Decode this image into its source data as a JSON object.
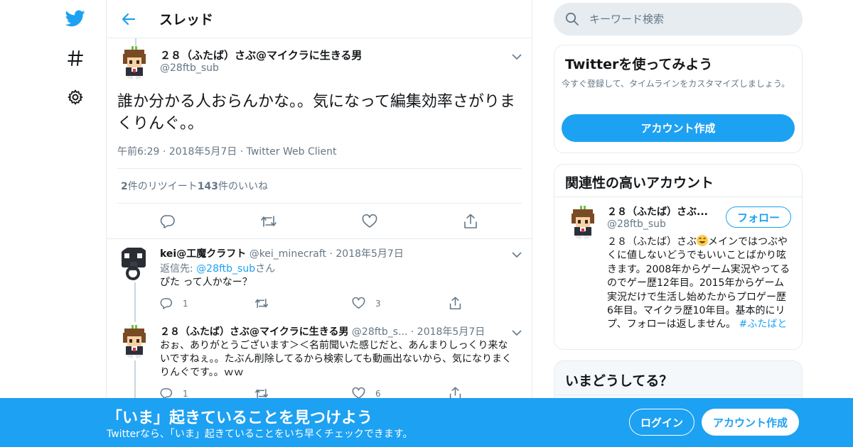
{
  "header": {
    "title": "スレッド"
  },
  "focus_tweet": {
    "name": "２８（ふたば）さぶ@マイクラに生きる男",
    "handle": "@28ftb_sub",
    "text": "誰か分かる人おらんかな。。気になって編集効率さがりまくりんぐ。。",
    "time": "午前6:29",
    "date": "2018年5月7日",
    "client": "Twitter Web Client",
    "retweet_count": "2",
    "retweet_label": "件のリツイート",
    "like_count": "143",
    "like_label": "件のいいね"
  },
  "replies": [
    {
      "name": "kei@工魔クラフト",
      "handle": "@kei_minecraft",
      "date": "2018年5月7日",
      "reply_to_prefix": "返信先: ",
      "reply_to_handle": "@28ftb_sub",
      "reply_to_suffix": "さん",
      "text": "ぴた って人かなー？",
      "reply_count": "1",
      "like_count": "3"
    },
    {
      "name": "２８（ふたば）さぶ@マイクラに生きる男",
      "handle": "@28ftb_s...",
      "date": "2018年5月7日",
      "text": "おぉ、ありがとうございます＞＜名前聞いた感じだと、あんまりしっくり来ないですねぇ。。たぶん削除してるから検索しても動画出ないから、気になりまくりんぐです。。ｗｗ",
      "reply_count": "1",
      "like_count": "6"
    }
  ],
  "sidebar": {
    "search_placeholder": "キーワード検索",
    "signup_card": {
      "title": "Twitterを使ってみよう",
      "text": "今すぐ登録して、タイムラインをカスタマイズしましょう。",
      "button": "アカウント作成"
    },
    "related_card": {
      "title": "関連性の高いアカウント",
      "name": "２８（ふたば）さぶ...",
      "handle": "@28ftb_sub",
      "follow": "フォロー",
      "bio_before": "２８（ふたば）さぶ",
      "bio_after": "メインではつぶやくに値しないどうでもいいことばかり呟きます。2008年からゲーム実況やってるのでゲー歴12年目。2015年からゲーム実況だけで生活し始めたからプロゲー歴6年目。マイクラ歴10年目。基本的にリプ、フォローは返しません。",
      "hashtag": "#ふたばと"
    },
    "trends_card": {
      "title": "いまどうしてる？"
    }
  },
  "banner": {
    "headline": "「いま」起きていることを見つけよう",
    "subtext": "Twitterなら、「いま」起きていることをいち早くチェックできます。",
    "login": "ログイン",
    "signup": "アカウント作成"
  },
  "colors": {
    "accent": "#1da1f2",
    "text": "#14171a",
    "muted": "#657786",
    "border": "#e6ecf0"
  },
  "icons": [
    "twitter-bird-icon",
    "hashtag-icon",
    "gear-icon",
    "back-arrow-icon",
    "chevron-down-icon",
    "reply-icon",
    "retweet-icon",
    "like-icon",
    "share-icon",
    "search-icon",
    "laughing-emoji-icon"
  ]
}
